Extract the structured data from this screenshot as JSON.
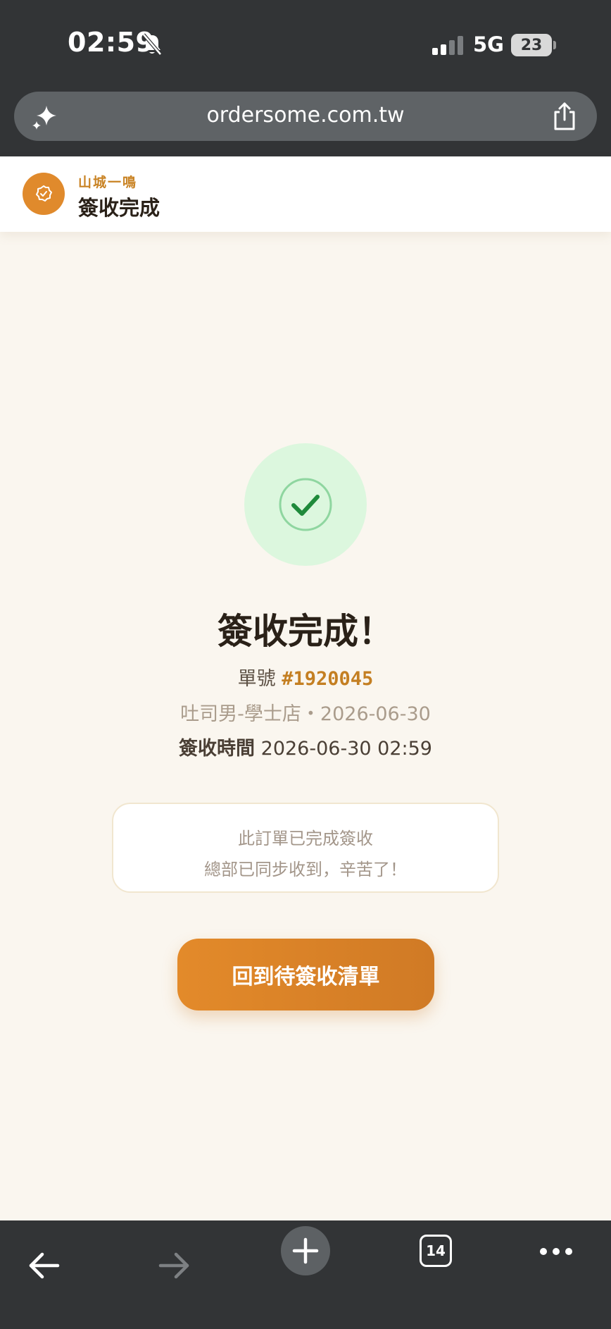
{
  "status_bar": {
    "time": "02:59",
    "network": "5G",
    "battery": "23"
  },
  "browser": {
    "url": "ordersome.com.tw",
    "tab_count": "14"
  },
  "header": {
    "brand": "山城一鳴",
    "title": "簽收完成"
  },
  "result": {
    "title": "簽收完成！",
    "order_label": "單號",
    "order_number": "#1920045",
    "store_date": "吐司男-學士店・2026-06-30",
    "sign_time_label": "簽收時間",
    "sign_time_value": "2026-06-30 02:59"
  },
  "notice": {
    "line1": "此訂單已完成簽收",
    "line2": "總部已同步收到，辛苦了！"
  },
  "actions": {
    "back_to_list_label": "回到待簽收清單"
  },
  "icons": {
    "status": [
      "bell-slash-icon",
      "signal-icon"
    ],
    "browser": [
      "sparkle-icon",
      "share-icon",
      "back-arrow-icon",
      "forward-arrow-icon",
      "plus-icon",
      "tabs-icon",
      "more-icon"
    ],
    "app": [
      "check-badge-icon",
      "check-circle-icon"
    ]
  },
  "colors": {
    "accent": "#e08a2c",
    "success_bg": "#dcf7de",
    "success": "#1f8a3b",
    "page_bg": "#faf6ef",
    "chrome": "#323436"
  }
}
